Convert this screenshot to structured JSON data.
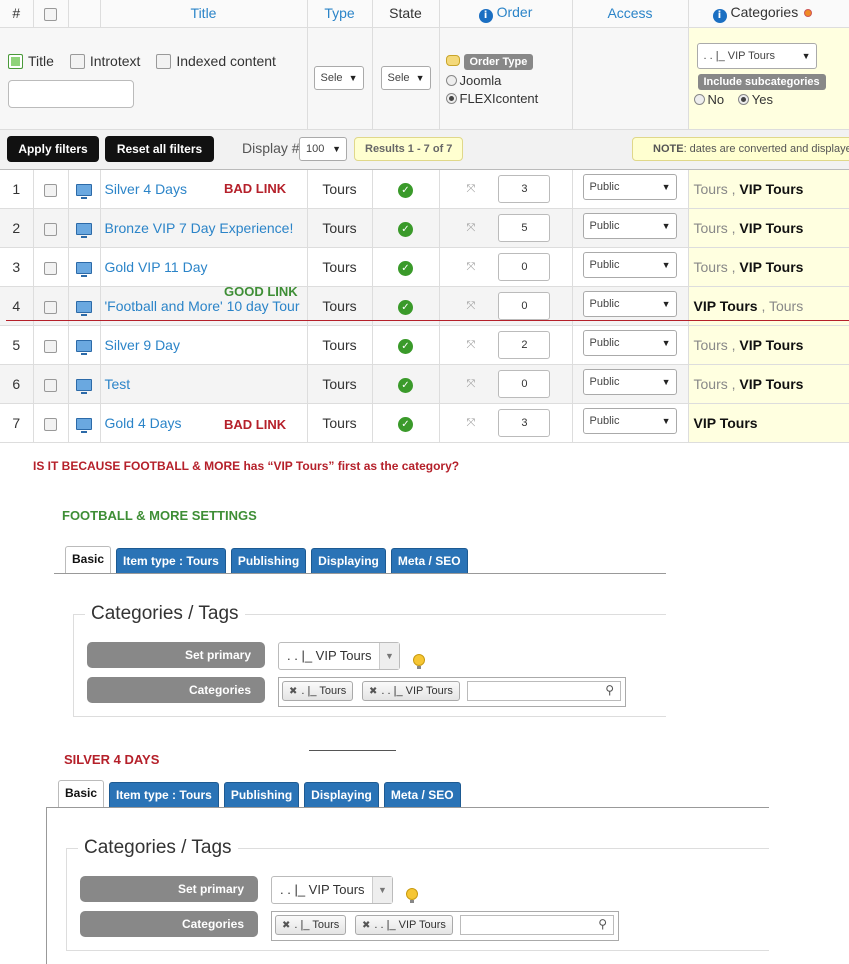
{
  "table": {
    "headers": {
      "num": "#",
      "title": "Title",
      "type": "Type",
      "state": "State",
      "order": "Order",
      "access": "Access",
      "categories": "Categories"
    },
    "filters": {
      "title_option": "Title",
      "introtext_option": "Introtext",
      "indexed_option": "Indexed content",
      "type_select": "Sele",
      "state_select": "Sele",
      "order_type_label": "Order Type",
      "order_joomla": "Joomla",
      "order_flexi": "FLEXIcontent",
      "category_select": ". . |_ VIP Tours",
      "include_sub_label": "Include subcategories",
      "include_no": "No",
      "include_yes": "Yes"
    },
    "toolbar": {
      "apply": "Apply filters",
      "reset": "Reset all filters",
      "display_label": "Display #",
      "display_value": "100",
      "results": "Results 1 - 7 of 7",
      "note_bold": "NOTE",
      "note_text": ": dates are converted and displayed"
    },
    "rows": [
      {
        "num": "1",
        "title": "Silver 4 Days",
        "type": "Tours",
        "order": "3",
        "access": "Public",
        "cat_first": "Tours",
        "cat_sep": " , ",
        "cat_second": "VIP Tours",
        "first_bold": false
      },
      {
        "num": "2",
        "title": "Bronze VIP 7 Day Experience!",
        "type": "Tours",
        "order": "5",
        "access": "Public",
        "cat_first": "Tours",
        "cat_sep": " , ",
        "cat_second": "VIP Tours",
        "first_bold": false
      },
      {
        "num": "3",
        "title": "Gold VIP 11 Day",
        "type": "Tours",
        "order": "0",
        "access": "Public",
        "cat_first": "Tours",
        "cat_sep": " , ",
        "cat_second": "VIP Tours",
        "first_bold": false
      },
      {
        "num": "4",
        "title": "'Football and More' 10 day Tour",
        "type": "Tours",
        "order": "0",
        "access": "Public",
        "cat_first": "VIP Tours",
        "cat_sep": " , ",
        "cat_second": "Tours",
        "first_bold": true
      },
      {
        "num": "5",
        "title": "Silver 9 Day",
        "type": "Tours",
        "order": "2",
        "access": "Public",
        "cat_first": "Tours",
        "cat_sep": " , ",
        "cat_second": "VIP Tours",
        "first_bold": false
      },
      {
        "num": "6",
        "title": "Test",
        "type": "Tours",
        "order": "0",
        "access": "Public",
        "cat_first": "Tours",
        "cat_sep": " , ",
        "cat_second": "VIP Tours",
        "first_bold": false
      },
      {
        "num": "7",
        "title": "Gold 4 Days",
        "type": "Tours",
        "order": "3",
        "access": "Public",
        "cat_first": "VIP Tours",
        "cat_sep": "",
        "cat_second": "",
        "first_bold": true
      }
    ]
  },
  "annotations": {
    "bad_link_1": "BAD LINK",
    "good_link": "GOOD LINK",
    "bad_link_7": "BAD LINK",
    "question": "IS IT BECAUSE FOOTBALL & MORE has “VIP Tours” first as the category?",
    "football_heading": "FOOTBALL & MORE SETTINGS",
    "silver_heading": "SILVER 4 DAYS"
  },
  "panel": {
    "tabs": [
      "Basic",
      "Item type : Tours",
      "Publishing",
      "Displaying",
      "Meta / SEO"
    ],
    "legend": "Categories / Tags",
    "set_primary_label": "Set primary",
    "primary_value": ". . |_ VIP Tours",
    "categories_label": "Categories",
    "chip_1": ". |_ Tours",
    "chip_2": ". . |_ VIP Tours"
  },
  "colors": {
    "link_blue": "#2b84c8",
    "annotation_red": "#b5202a",
    "annotation_green": "#3e8e35",
    "tab_blue": "#2a73b6",
    "category_highlight": "#ffffe0"
  }
}
